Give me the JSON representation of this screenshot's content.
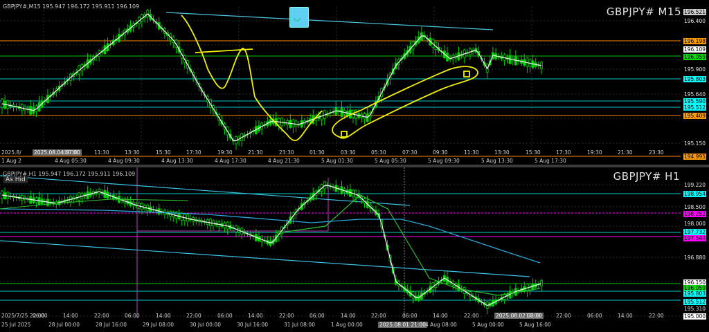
{
  "m15": {
    "ohlc": "GBPJPY#,M15  195.947 196.172 195.911 196.109",
    "title": "GBPJPY# M15",
    "price_ticks": [
      "196.521",
      "196.400",
      "196.109",
      "195.900",
      "195.640",
      "195.512",
      "195.150",
      "194.995"
    ],
    "price_labels": [
      {
        "text": "196.198",
        "color": "#ff9a00"
      },
      {
        "text": "196.109",
        "color": "#ffffff"
      },
      {
        "text": "196.059",
        "color": "#00e000"
      },
      {
        "text": "195.803",
        "color": "#00ffff"
      },
      {
        "text": "195.590",
        "color": "#00ffff"
      },
      {
        "text": "195.512",
        "color": "#00ffff"
      },
      {
        "text": "195.409",
        "color": "#ff9a00"
      }
    ],
    "time_labels": [
      "2025.8/",
      "2025.08.04 07:00",
      "09:30",
      "11:30",
      "13:30",
      "15:30",
      "17:30",
      "19:30",
      "21:30",
      "23:30",
      "01:30",
      "03:30",
      "05:30",
      "07:30",
      "09:30",
      "11:30",
      "13:30",
      "15:30",
      "17:30",
      "19:30",
      "21:30",
      "23:30"
    ],
    "date_labels": [
      "1 Aug 2",
      "4 Aug 05:30",
      "4 Aug 09:30",
      "4 Aug 13:30",
      "4 Aug 17:30",
      "4 Aug 21:30",
      "5 Aug 01:30",
      "5 Aug 05:30",
      "5 Aug 09:30",
      "5 Aug 13:30",
      "5 Aug 17:30"
    ]
  },
  "h1": {
    "ohlc": "GBPJPY#,H1  195.947 196.172 195.911 196.109",
    "tag": "As Hid",
    "title": "GBPJPY# H1",
    "price_ticks": [
      "199.220",
      "198.500",
      "198.000",
      "196.880",
      "195.310",
      "195.000"
    ],
    "price_labels": [
      {
        "text": "198.954",
        "color": "#00ffff"
      },
      {
        "text": "198.252",
        "color": "#ff00ff"
      },
      {
        "text": "197.732",
        "color": "#00ffff"
      },
      {
        "text": "197.544",
        "color": "#ff00ff"
      },
      {
        "text": "196.150",
        "color": "#ffffff"
      },
      {
        "text": "196.059",
        "color": "#00e000"
      },
      {
        "text": "195.803",
        "color": "#00ffff"
      },
      {
        "text": "195.512",
        "color": "#00ffff"
      }
    ],
    "time_labels": [
      "2025/7/25 22:00",
      "06:00",
      "14:00",
      "22:00",
      "06:00",
      "14:00",
      "22:00",
      "06:00",
      "14:00",
      "22:00",
      "06:00",
      "14:00",
      "22:00",
      "06:00",
      "14:00",
      "22:00",
      "2025.08.02 03:00",
      "14:00",
      "22:00",
      "06:00",
      "14:00",
      "22:00"
    ],
    "date_labels": [
      "25 Jul 2025",
      "28 Jul 00:00",
      "28 Jul 16:00",
      "29 Jul 08:00",
      "30 Jul 00:00",
      "30 Jul 16:00",
      "31 Jul 08:00",
      "1 Aug 00:00",
      "2025.08.01 21:00",
      "4 Aug 08:00",
      "5 Aug 00:00",
      "5 Aug 16:00"
    ]
  }
}
